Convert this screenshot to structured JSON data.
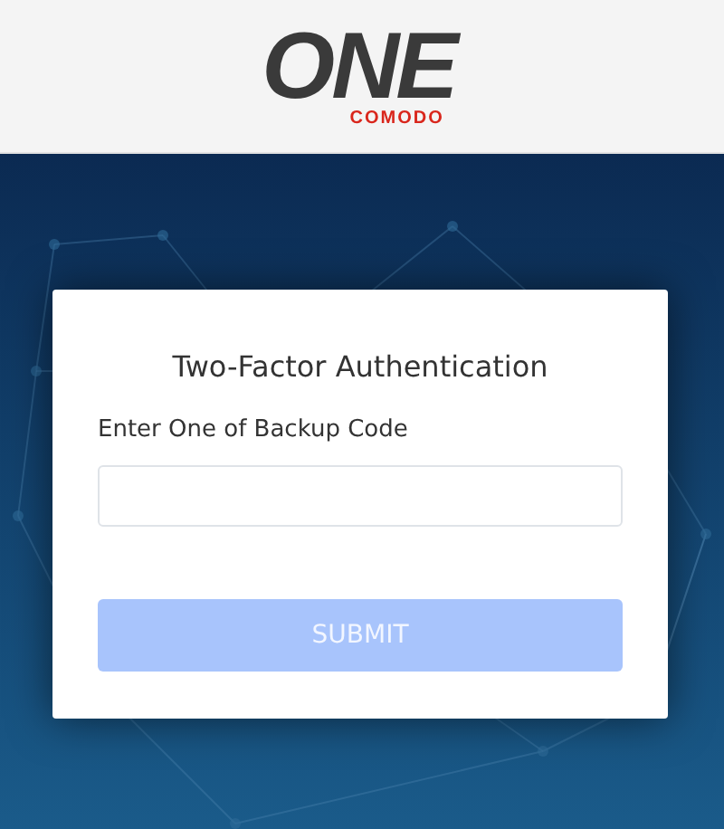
{
  "header": {
    "logo": {
      "wordmark": "ONE",
      "brand": "COMODO"
    }
  },
  "card": {
    "title": "Two-Factor Authentication",
    "field": {
      "label": "Enter One of Backup Code"
    },
    "submit": {
      "label": "SUBMIT",
      "disabled": true
    }
  }
}
